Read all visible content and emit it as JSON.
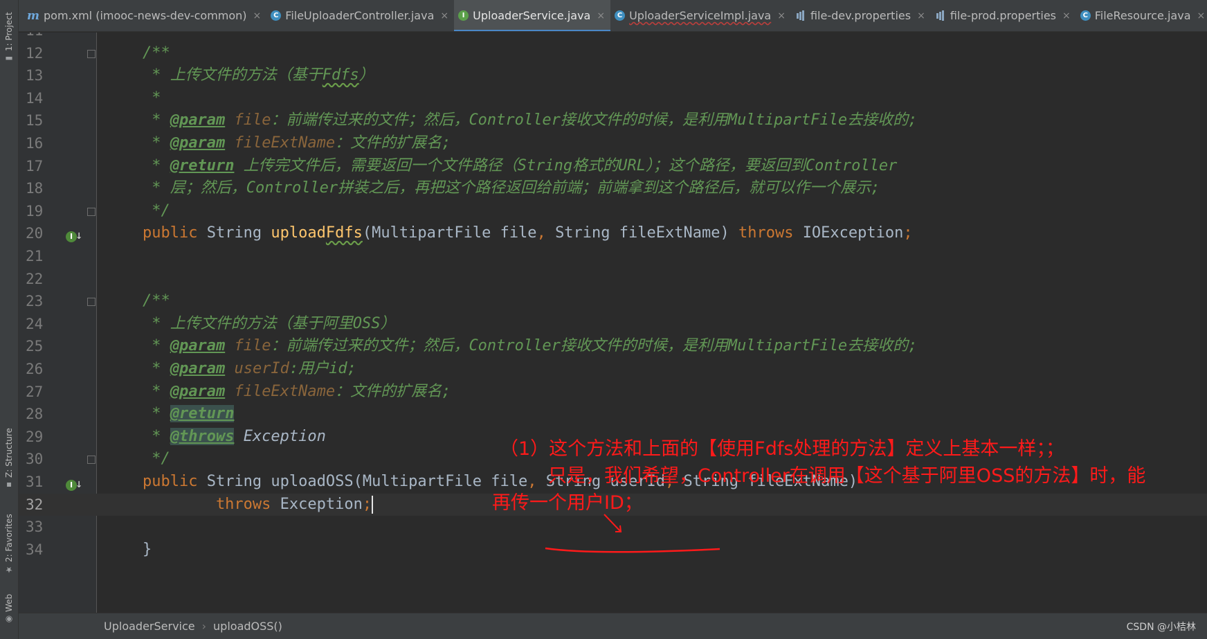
{
  "tabs": [
    {
      "label": "pom.xml (imooc-news-dev-common)",
      "icon": "maven-icon",
      "glyph": "m",
      "active": false,
      "error": false
    },
    {
      "label": "FileUploaderController.java",
      "icon": "class-icon",
      "glyph": "C",
      "active": false,
      "error": false
    },
    {
      "label": "UploaderService.java",
      "icon": "interface-icon",
      "glyph": "I",
      "active": true,
      "error": false
    },
    {
      "label": "UploaderServiceImpl.java",
      "icon": "class-icon",
      "glyph": "C",
      "active": false,
      "error": true
    },
    {
      "label": "file-dev.properties",
      "icon": "properties-icon",
      "glyph": "",
      "active": false,
      "error": false
    },
    {
      "label": "file-prod.properties",
      "icon": "properties-icon",
      "glyph": "",
      "active": false,
      "error": false
    },
    {
      "label": "FileResource.java",
      "icon": "class-icon",
      "glyph": "C",
      "active": false,
      "error": false
    }
  ],
  "tab_close": "×",
  "tool_windows": {
    "project": "1: Project",
    "structure": "Z: Structure",
    "favorites": "2: Favorites",
    "web": "Web"
  },
  "editor": {
    "current_line": "32",
    "lines": [
      {
        "n": "11",
        "parts": []
      },
      {
        "n": "12",
        "parts": [
          [
            "cm",
            "    /**"
          ]
        ]
      },
      {
        "n": "13",
        "parts": [
          [
            "cm",
            "     * 上传文件的方法（基于"
          ],
          [
            "cm typo",
            "Fdfs"
          ],
          [
            "cm",
            "）"
          ]
        ]
      },
      {
        "n": "14",
        "parts": [
          [
            "cm",
            "     *"
          ]
        ]
      },
      {
        "n": "15",
        "parts": [
          [
            "cm",
            "     * "
          ],
          [
            "tag",
            "@param"
          ],
          [
            "cm",
            " "
          ],
          [
            "pn",
            "file"
          ],
          [
            "cm",
            "：前端传过来的文件；然后，Controller接收文件的时候，是利用MultipartFile去接收的;"
          ]
        ]
      },
      {
        "n": "16",
        "parts": [
          [
            "cm",
            "     * "
          ],
          [
            "tag",
            "@param"
          ],
          [
            "cm",
            " "
          ],
          [
            "pn",
            "fileExtName"
          ],
          [
            "cm",
            "：文件的扩展名;"
          ]
        ]
      },
      {
        "n": "17",
        "parts": [
          [
            "cm",
            "     * "
          ],
          [
            "tag",
            "@return"
          ],
          [
            "cm",
            " 上传完文件后，需要返回一个文件路径（String格式的URL）；这个路径，要返回到Controller"
          ]
        ]
      },
      {
        "n": "18",
        "parts": [
          [
            "cm",
            "     * 层；然后，Controller拼装之后，再把这个路径返回给前端；前端拿到这个路径后，就可以作一个展示;"
          ]
        ]
      },
      {
        "n": "19",
        "parts": [
          [
            "cm",
            "     */"
          ]
        ]
      },
      {
        "n": "20",
        "parts": [
          [
            "kw",
            "    public "
          ],
          [
            "",
            "String "
          ],
          [
            "fn",
            "upload"
          ],
          [
            "fn typo",
            "Fdfs"
          ],
          [
            "",
            "(MultipartFile file"
          ],
          [
            "kw",
            ", "
          ],
          [
            "",
            "String fileExtName) "
          ],
          [
            "kw",
            "throws "
          ],
          [
            "",
            "IOException"
          ],
          [
            "kw",
            ";"
          ]
        ]
      },
      {
        "n": "21",
        "parts": []
      },
      {
        "n": "22",
        "parts": []
      },
      {
        "n": "23",
        "parts": [
          [
            "cm",
            "    /**"
          ]
        ]
      },
      {
        "n": "24",
        "parts": [
          [
            "cm",
            "     * 上传文件的方法（基于阿里OSS）"
          ]
        ]
      },
      {
        "n": "25",
        "parts": [
          [
            "cm",
            "     * "
          ],
          [
            "tag",
            "@param"
          ],
          [
            "cm",
            " "
          ],
          [
            "pn",
            "file"
          ],
          [
            "cm",
            "：前端传过来的文件；然后，Controller接收文件的时候，是利用MultipartFile去接收的;"
          ]
        ]
      },
      {
        "n": "26",
        "parts": [
          [
            "cm",
            "     * "
          ],
          [
            "tag",
            "@param"
          ],
          [
            "cm",
            " "
          ],
          [
            "pn",
            "userId"
          ],
          [
            "cm",
            ":用户id;"
          ]
        ]
      },
      {
        "n": "27",
        "parts": [
          [
            "cm",
            "     * "
          ],
          [
            "tag",
            "@param"
          ],
          [
            "cm",
            " "
          ],
          [
            "pn",
            "fileExtName"
          ],
          [
            "cm",
            "：文件的扩展名;"
          ]
        ]
      },
      {
        "n": "28",
        "parts": [
          [
            "cm",
            "     * "
          ],
          [
            "tag hl",
            "@return"
          ]
        ]
      },
      {
        "n": "29",
        "parts": [
          [
            "cm",
            "     * "
          ],
          [
            "tag hl",
            "@throws"
          ],
          [
            "cm",
            " "
          ],
          [
            "ex",
            "Exception"
          ]
        ]
      },
      {
        "n": "30",
        "parts": [
          [
            "cm",
            "     */"
          ]
        ]
      },
      {
        "n": "31",
        "parts": [
          [
            "kw",
            "    public "
          ],
          [
            "",
            "String uploadOSS(MultipartFile file"
          ],
          [
            "kw",
            ", "
          ],
          [
            "",
            "String userId"
          ],
          [
            "kw",
            ", "
          ],
          [
            "",
            "String fileExtName)"
          ]
        ]
      },
      {
        "n": "32",
        "parts": [
          [
            "kw",
            "            throws "
          ],
          [
            "",
            "Exception"
          ],
          [
            "kw",
            ";"
          ]
        ]
      },
      {
        "n": "33",
        "parts": []
      },
      {
        "n": "34",
        "parts": [
          [
            "",
            "    }"
          ]
        ]
      }
    ]
  },
  "annotation": {
    "line1": "（1）这个方法和上面的【使用Fdfs处理的方法】定义上基本一样；；",
    "line2": "只是，我们希望，Controller在调用【这个基于阿里OSS的方法】时，能",
    "line3": "再传一个用户ID；",
    "color": "#ff1a1a"
  },
  "breadcrumb": {
    "items": [
      "UploaderService",
      "uploadOSS()"
    ],
    "separator": "›"
  },
  "watermark": "CSDN @小桔林",
  "colors": {
    "background": "#2b2b2b",
    "comment": "#629755",
    "keyword": "#cc7832",
    "method": "#ffc66d",
    "accent": "#4a88c7"
  }
}
